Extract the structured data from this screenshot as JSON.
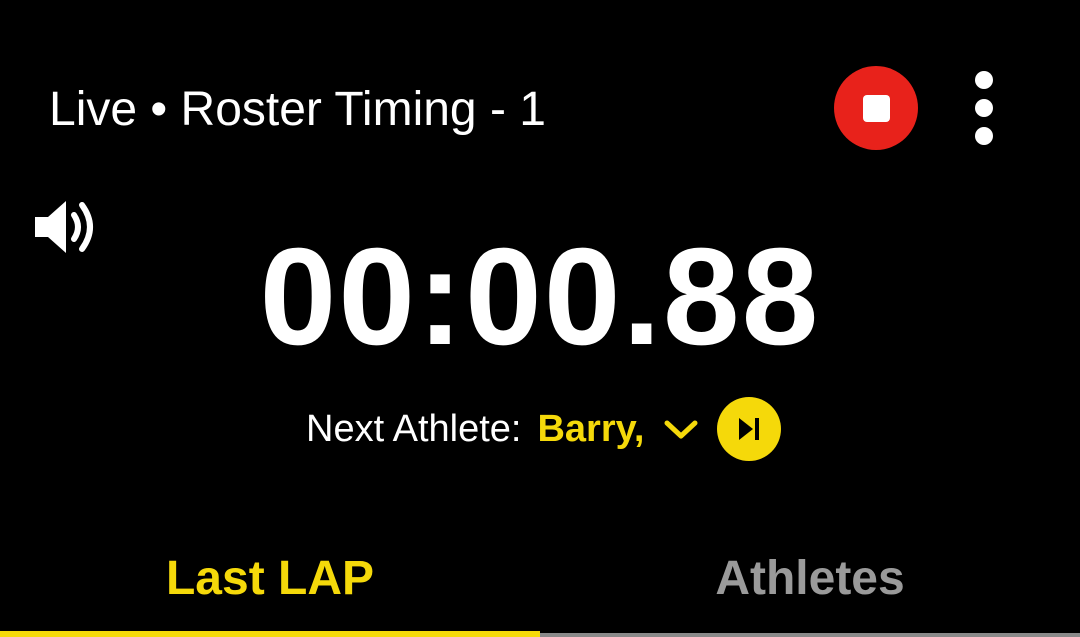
{
  "header": {
    "title": "Live • Roster Timing - 1",
    "stop_icon": "stop-icon",
    "more_icon": "more-vertical-icon"
  },
  "volume": {
    "icon": "volume-icon"
  },
  "timer": {
    "value": "00:00.88"
  },
  "next_athlete": {
    "label": "Next Athlete:",
    "name": "Barry,",
    "dropdown_icon": "chevron-down-icon",
    "skip_icon": "skip-next-icon"
  },
  "tabs": [
    {
      "label": "Last LAP",
      "active": true
    },
    {
      "label": "Athletes",
      "active": false
    }
  ],
  "colors": {
    "background": "#000000",
    "accent": "#f5d90a",
    "stop": "#e8221b",
    "inactive_tab": "#9a9a9a"
  }
}
